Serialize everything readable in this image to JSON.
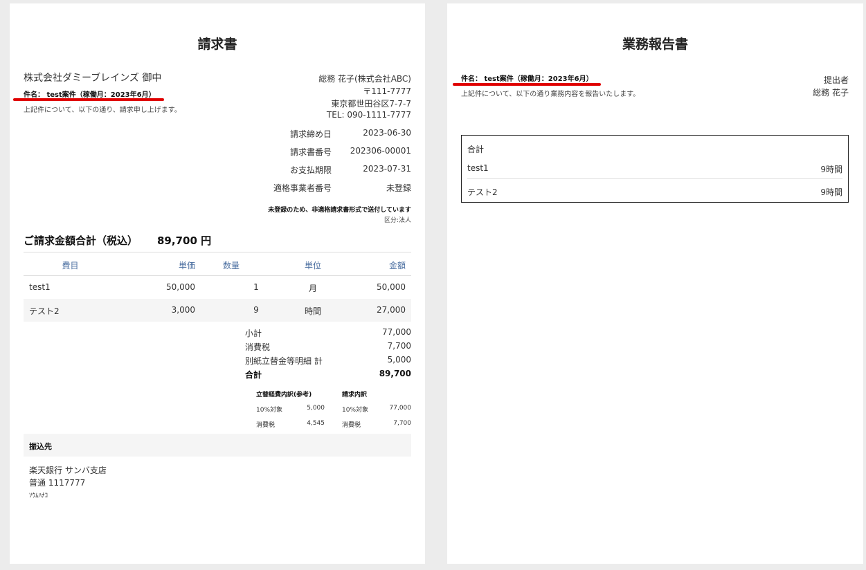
{
  "invoice": {
    "title": "請求書",
    "client": "株式会社ダミーブレインズ 御中",
    "subject": "件名： test案件（稼働月：2023年6月）",
    "intro": "上記件について、以下の通り、請求申し上げます。",
    "issuer": {
      "name": "総務 花子(株式会社ABC)",
      "postal": "〒111-7777",
      "address": "東京都世田谷区7-7-7",
      "tel": "TEL: 090-1111-7777"
    },
    "meta": [
      {
        "label": "請求締め日",
        "value": "2023-06-30"
      },
      {
        "label": "請求書番号",
        "value": "202306-00001"
      },
      {
        "label": "お支払期限",
        "value": "2023-07-31"
      },
      {
        "label": "適格事業者番号",
        "value": "未登録"
      }
    ],
    "notice": "未登録のため、非適格請求書形式で送付しています",
    "category": "区分:法人",
    "total_label": "ご請求金額合計（税込）",
    "total_value": "89,700 円",
    "table_headers": {
      "item": "費目",
      "unit_price": "単価",
      "qty": "数量",
      "unit": "単位",
      "amount": "金額"
    },
    "rows": [
      {
        "item": "test1",
        "unit_price": "50,000",
        "qty": "1",
        "unit": "月",
        "amount": "50,000"
      },
      {
        "item": "テスト2",
        "unit_price": "3,000",
        "qty": "9",
        "unit": "時間",
        "amount": "27,000"
      }
    ],
    "summary": [
      {
        "label": "小計",
        "value": "77,000"
      },
      {
        "label": "消費税",
        "value": "7,700"
      },
      {
        "label": "別紙立替金等明細 計",
        "value": "5,000"
      },
      {
        "label": "合計",
        "value": "89,700"
      }
    ],
    "breakdown": {
      "left_title": "立替経費内訳(参考)",
      "right_title": "請求内訳",
      "rows": [
        {
          "l_label": "10%対象",
          "l_value": "5,000",
          "r_label": "10%対象",
          "r_value": "77,000"
        },
        {
          "l_label": "消費税",
          "l_value": "4,545",
          "r_label": "消費税",
          "r_value": "7,700"
        }
      ]
    },
    "bank": {
      "heading": "振込先",
      "line1": "楽天銀行 サンバ支店",
      "line2": "普通 1117777",
      "line3": "ｿｳﾑﾊﾅｺ"
    }
  },
  "report": {
    "title": "業務報告書",
    "subject": "件名： test案件（稼働月：2023年6月）",
    "intro": "上記件について、以下の通り業務内容を報告いたします。",
    "submitter_label": "提出者",
    "submitter_name": "総務 花子",
    "box_title": "合計",
    "rows": [
      {
        "name": "test1",
        "hours": "9時間"
      },
      {
        "name": "テスト2",
        "hours": "9時間"
      }
    ]
  },
  "colors": {
    "highlight_underline": "#e00000",
    "header_text": "#4a6ea0",
    "row_bg": "#f5f5f5"
  }
}
